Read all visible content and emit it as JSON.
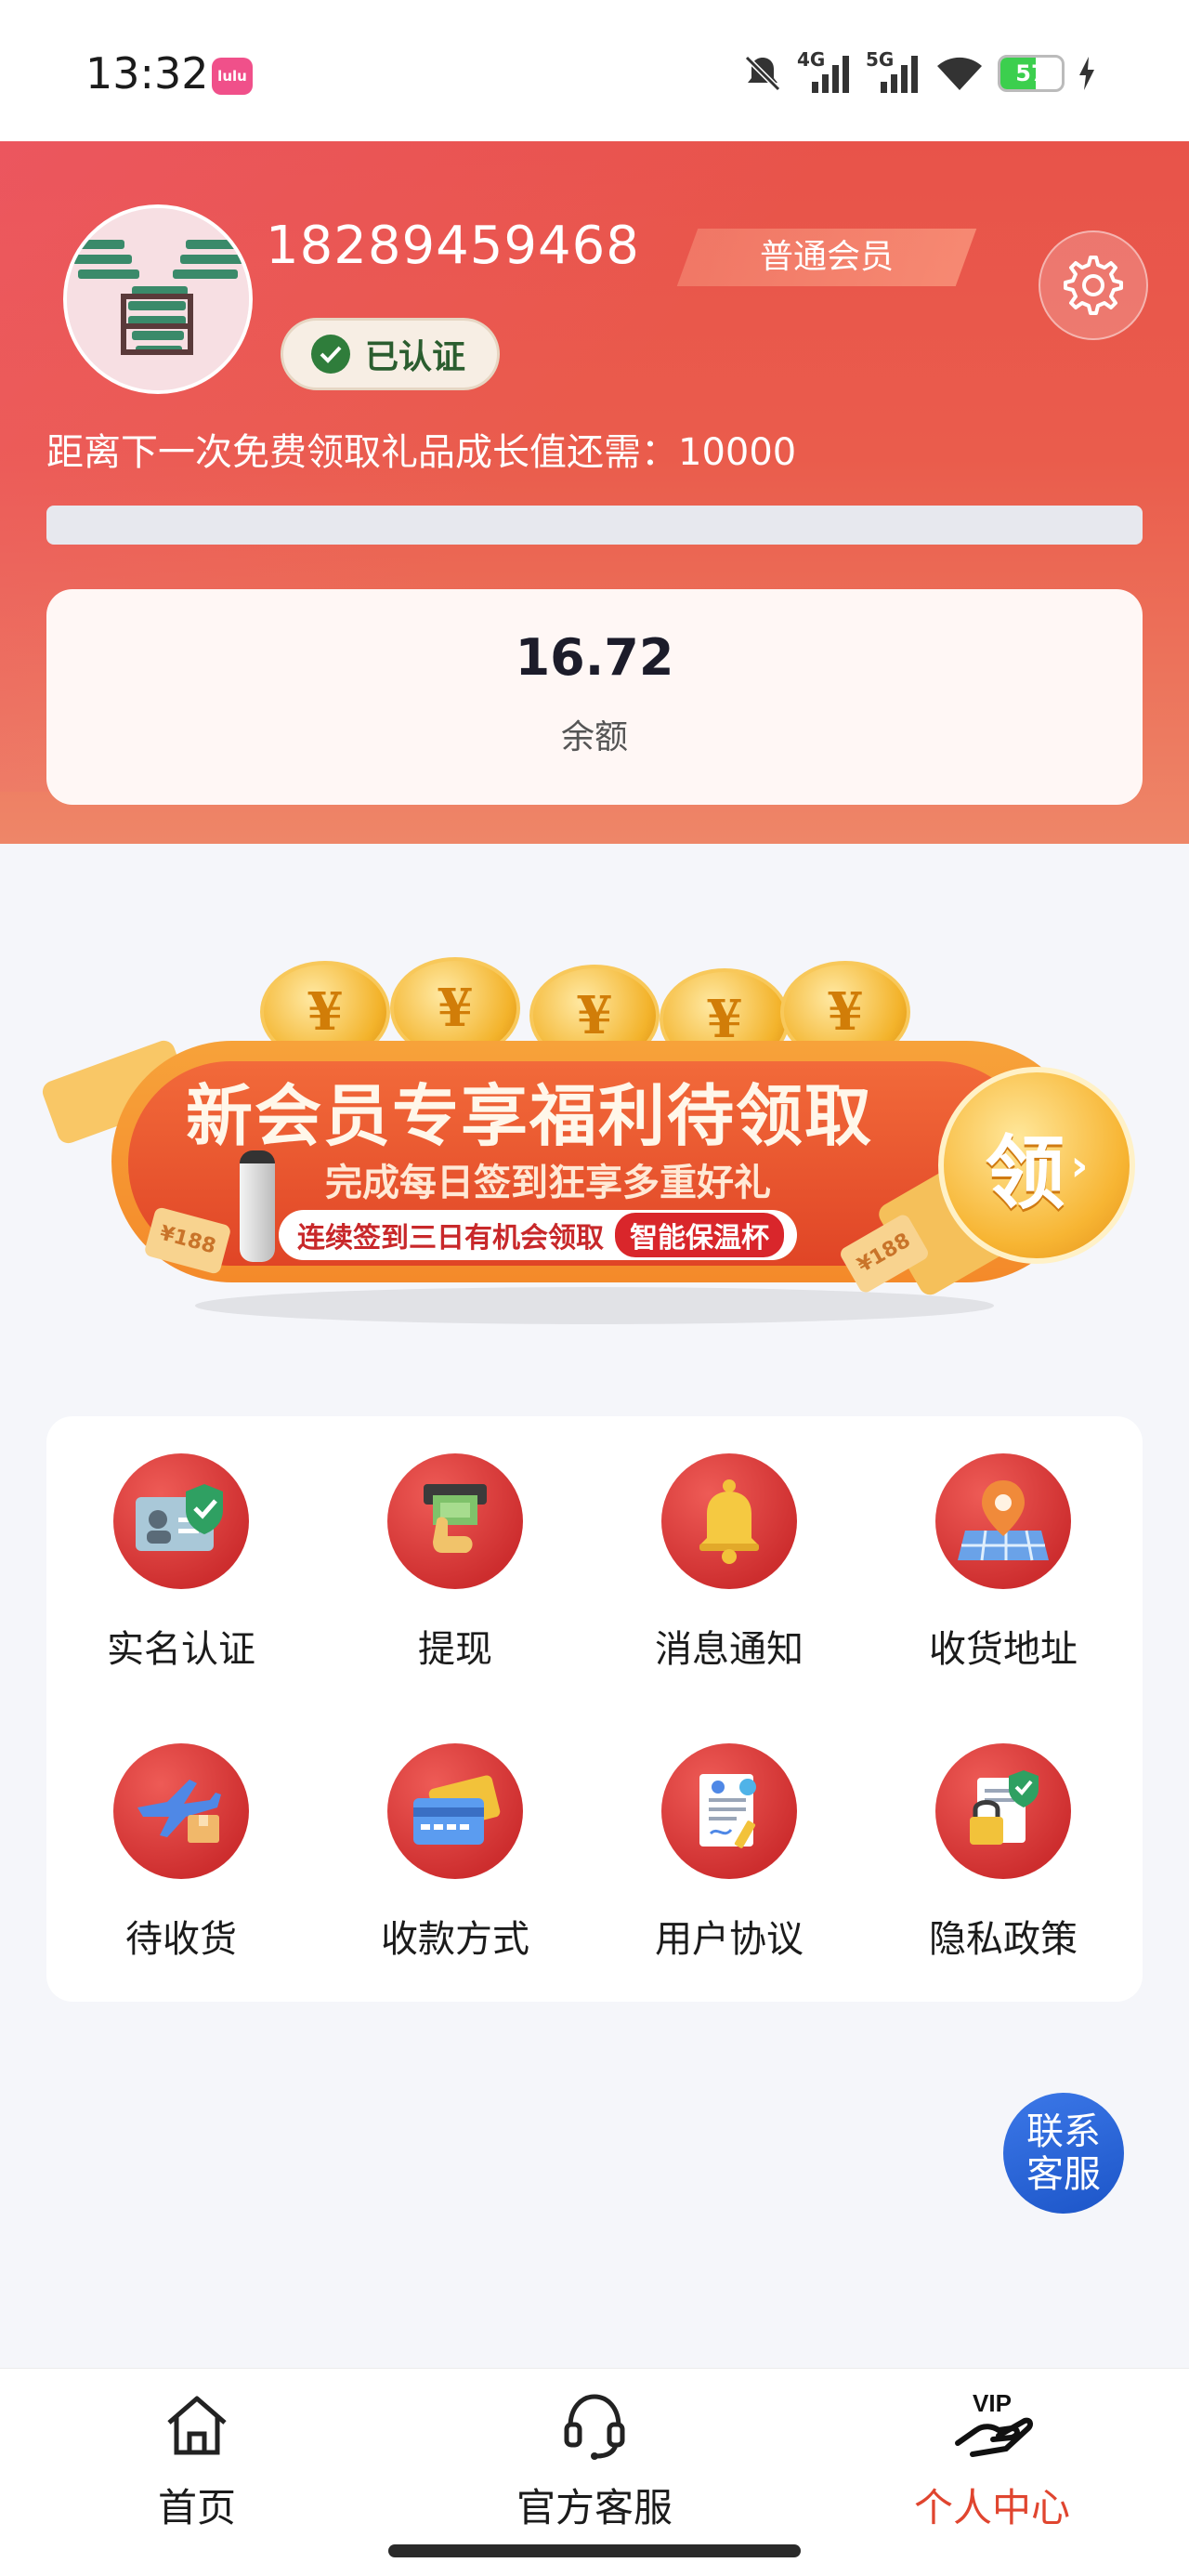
{
  "status_bar": {
    "time": "13:32",
    "app_badge": "lulu",
    "net_4g": "4G",
    "net_5g": "5G",
    "battery_level": 57,
    "battery_text": "57",
    "icons": [
      "mute-icon",
      "signal-4g-icon",
      "signal-5g-icon",
      "wifi-icon",
      "battery-icon",
      "charging-icon"
    ]
  },
  "profile": {
    "phone": "18289459468",
    "verified_label": "已认证",
    "member_level": "普通会员",
    "growth_text": "距离下一次免费领取礼品成长值还需：10000",
    "growth_progress": 0,
    "balance_value": "16.72",
    "balance_label": "余额"
  },
  "banner": {
    "title": "新会员专享福利待领取",
    "subtitle": "完成每日签到狂享多重好礼",
    "pill_text": "连续签到三日有机会领取",
    "pill_tag": "智能保温杯",
    "claim": "领",
    "coin_symbol": "¥",
    "coupon_left": "¥188",
    "coupon_right": "¥188"
  },
  "grid": {
    "items": [
      {
        "label": "实名认证",
        "icon": "id-card-icon"
      },
      {
        "label": "提现",
        "icon": "withdraw-icon"
      },
      {
        "label": "消息通知",
        "icon": "bell-icon"
      },
      {
        "label": "收货地址",
        "icon": "map-pin-icon"
      },
      {
        "label": "待收货",
        "icon": "plane-package-icon"
      },
      {
        "label": "收款方式",
        "icon": "credit-card-icon"
      },
      {
        "label": "用户协议",
        "icon": "agreement-icon"
      },
      {
        "label": "隐私政策",
        "icon": "privacy-lock-icon"
      }
    ]
  },
  "fab": {
    "label": "联系客服"
  },
  "nav": {
    "items": [
      {
        "label": "首页",
        "icon": "home-icon"
      },
      {
        "label": "官方客服",
        "icon": "headset-icon"
      },
      {
        "label": "个人中心",
        "icon": "vip-hand-icon",
        "badge": "VIP"
      }
    ]
  },
  "colors": {
    "header_red": "#e8534a",
    "accent_orange": "#f48a2a",
    "active_nav": "#e0452f",
    "fab_blue": "#2a64d8"
  }
}
